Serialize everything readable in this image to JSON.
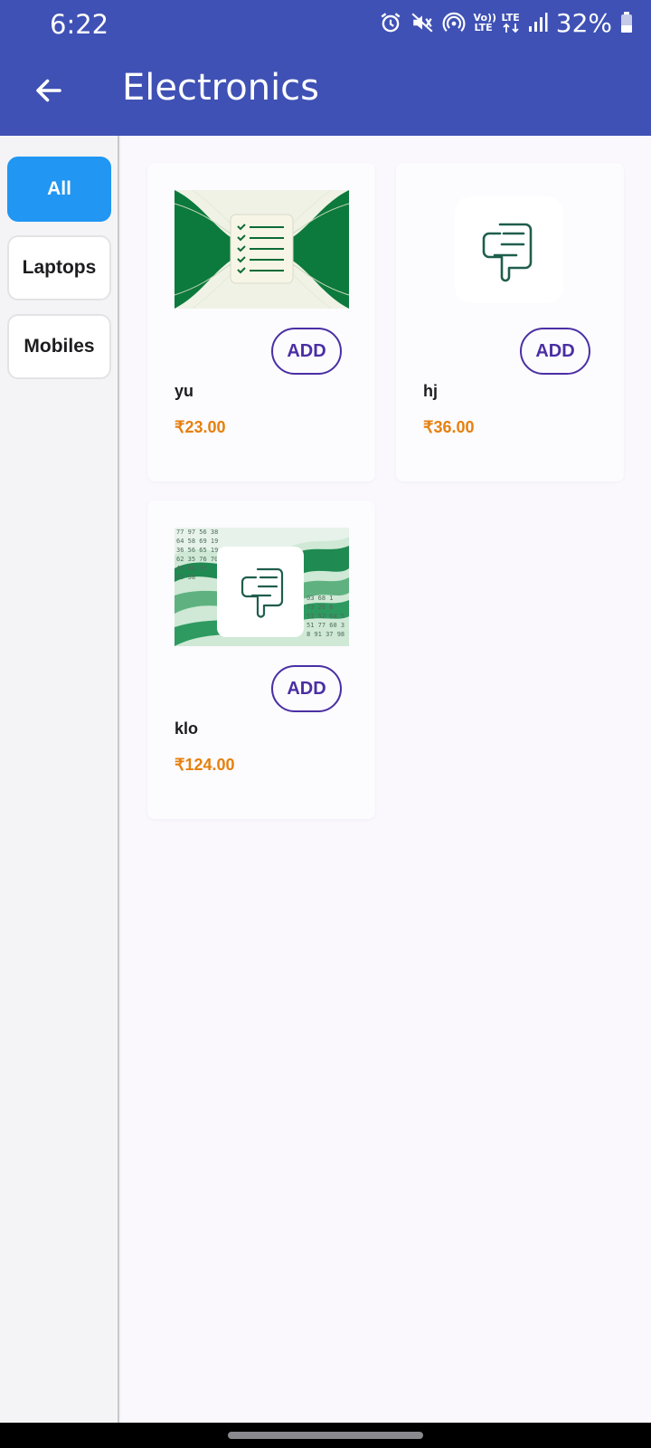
{
  "status_bar": {
    "time": "6:22",
    "lte_top": "Vo)) LTE",
    "lte_arrows": "LTE",
    "battery_percent": "32%",
    "icons": [
      "alarm-icon",
      "mute-icon",
      "hotspot-icon",
      "volte-icon",
      "lte-data-icon",
      "signal-icon",
      "battery-icon"
    ]
  },
  "app_bar": {
    "title": "Electronics",
    "back_icon": "arrow-left-icon"
  },
  "sidebar": {
    "categories": [
      {
        "label": "All",
        "active": true
      },
      {
        "label": "Laptops",
        "active": false
      },
      {
        "label": "Mobiles",
        "active": false
      }
    ]
  },
  "products": [
    {
      "name": "yu",
      "price": "₹23.00",
      "add_label": "ADD",
      "image_icon": "checklist-icon"
    },
    {
      "name": "hj",
      "price": "₹36.00",
      "add_label": "ADD",
      "image_icon": "document-icon"
    },
    {
      "name": "klo",
      "price": "₹124.00",
      "add_label": "ADD",
      "image_icon": "document-icon"
    }
  ],
  "colors": {
    "app_bar": "#3f51b5",
    "active_category": "#2196f3",
    "add_button": "#4a2fa4",
    "price": "#e6800e"
  }
}
